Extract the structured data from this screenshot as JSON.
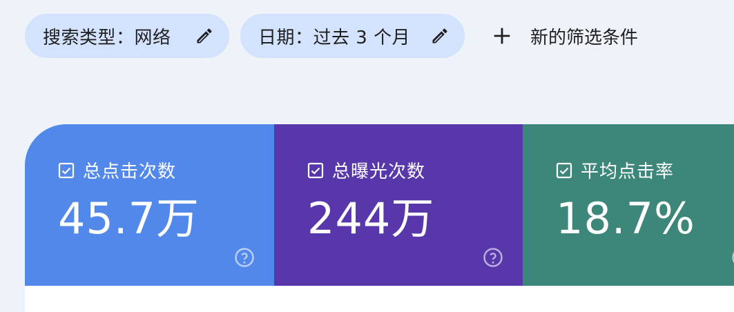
{
  "filters": {
    "search_type": "搜索类型：网络",
    "date": "日期：过去 3 个月",
    "new_filter": "新的筛选条件"
  },
  "metrics": [
    {
      "label": "总点击次数",
      "value": "45.7万",
      "color": "#5288ea",
      "checked": true
    },
    {
      "label": "总曝光次数",
      "value": "244万",
      "color": "#5837ab",
      "checked": true
    },
    {
      "label": "平均点击率",
      "value": "18.7%",
      "color": "#3c877a",
      "checked": true
    }
  ],
  "icons": {
    "edit": "pencil-icon",
    "add": "plus-icon",
    "checkbox": "checkbox-checked-icon",
    "help": "help-circle-icon"
  }
}
